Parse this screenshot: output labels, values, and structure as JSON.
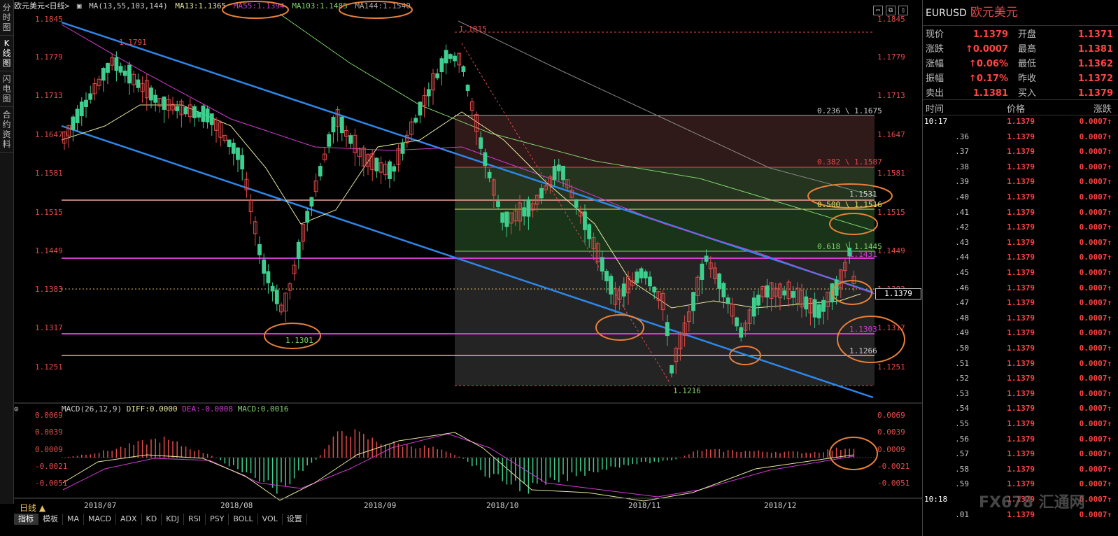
{
  "left_tabs": [
    {
      "label": "分时图"
    },
    {
      "label": "K线图"
    },
    {
      "label": "闪电图"
    },
    {
      "label": "合约资料"
    }
  ],
  "title_bar": {
    "instrument": "欧元美元<日线>",
    "ma_label": "MA(13,55,103,144)",
    "ma13": "MA13:1.1365",
    "ma55": "MA55:1.1394",
    "ma103": "MA103:1.1485",
    "ma144": "MA144:1.1540"
  },
  "price_axis": [
    "1.1845",
    "1.1779",
    "1.1713",
    "1.1647",
    "1.1581",
    "1.1515",
    "1.1449",
    "1.1383",
    "1.1317",
    "1.1251"
  ],
  "annotations": {
    "high1": "1.1791",
    "high2": "1.1815",
    "low1": "1.1301",
    "low2": "1.1216",
    "fib236": "0.236 \\ 1.1675",
    "fib382": "0.382 \\ 1.1587",
    "fib500": "0.500 \\ 1.1516",
    "fib618": "0.618 \\ 1.1445",
    "lvl1531": "1.1531",
    "lvl1431": "1.1431",
    "lvl1303": "1.1303",
    "lvl1266": "1.1266",
    "current_price_tag": "1.1379",
    "right_1383": "1.1383"
  },
  "macd": {
    "label": "MACD(26,12,9)",
    "diff": "DIFF:0.0000",
    "dea": "DEA:-0.0008",
    "macd": "MACD:0.0016",
    "axis": [
      "0.0069",
      "0.0039",
      "0.0009",
      "-0.0021",
      "-0.0051"
    ]
  },
  "x_axis": [
    "2018/07",
    "2018/08",
    "2018/09",
    "2018/10",
    "2018/11",
    "2018/12"
  ],
  "bottom_tabs": [
    "指标",
    "模板",
    "MA",
    "MACD",
    "ADX",
    "KD",
    "KDJ",
    "RSI",
    "PSY",
    "BOLL",
    "VOL",
    "设置"
  ],
  "period_label": "日线 ▲",
  "quote": {
    "symbol": "EURUSD",
    "name": "欧元美元",
    "rows": [
      {
        "l1": "现价",
        "v1": "1.1379",
        "l2": "开盘",
        "v2": "1.1371"
      },
      {
        "l1": "涨跌",
        "v1": "↑0.0007",
        "l2": "最高",
        "v2": "1.1381"
      },
      {
        "l1": "涨幅",
        "v1": "↑0.06%",
        "l2": "最低",
        "v2": "1.1362"
      },
      {
        "l1": "振幅",
        "v1": "↑0.17%",
        "l2": "昨收",
        "v2": "1.1372"
      },
      {
        "l1": "卖出",
        "v1": "1.1381",
        "l2": "买入",
        "v2": "1.1379"
      }
    ]
  },
  "ticks_header": {
    "time": "时间",
    "price": "价格",
    "change": "涨跌"
  },
  "ticks": [
    {
      "t": "10:17",
      "p": "1.1379",
      "c": "0.0007↑"
    },
    {
      "t": ".36",
      "p": "1.1379",
      "c": "0.0007↑"
    },
    {
      "t": ".37",
      "p": "1.1379",
      "c": "0.0007↑"
    },
    {
      "t": ".38",
      "p": "1.1379",
      "c": "0.0007↑"
    },
    {
      "t": ".39",
      "p": "1.1379",
      "c": "0.0007↑"
    },
    {
      "t": ".40",
      "p": "1.1379",
      "c": "0.0007↑"
    },
    {
      "t": ".41",
      "p": "1.1379",
      "c": "0.0007↑"
    },
    {
      "t": ".42",
      "p": "1.1379",
      "c": "0.0007↑"
    },
    {
      "t": ".43",
      "p": "1.1379",
      "c": "0.0007↑"
    },
    {
      "t": ".44",
      "p": "1.1379",
      "c": "0.0007↑"
    },
    {
      "t": ".45",
      "p": "1.1379",
      "c": "0.0007↑"
    },
    {
      "t": ".46",
      "p": "1.1379",
      "c": "0.0007↑"
    },
    {
      "t": ".47",
      "p": "1.1379",
      "c": "0.0007↑"
    },
    {
      "t": ".48",
      "p": "1.1379",
      "c": "0.0007↑"
    },
    {
      "t": ".49",
      "p": "1.1379",
      "c": "0.0007↑"
    },
    {
      "t": ".50",
      "p": "1.1379",
      "c": "0.0007↑"
    },
    {
      "t": ".51",
      "p": "1.1379",
      "c": "0.0007↑"
    },
    {
      "t": ".52",
      "p": "1.1379",
      "c": "0.0007↑"
    },
    {
      "t": ".53",
      "p": "1.1379",
      "c": "0.0007↑"
    },
    {
      "t": ".54",
      "p": "1.1379",
      "c": "0.0007↑"
    },
    {
      "t": ".55",
      "p": "1.1379",
      "c": "0.0007↑"
    },
    {
      "t": ".56",
      "p": "1.1379",
      "c": "0.0007↑"
    },
    {
      "t": ".57",
      "p": "1.1379",
      "c": "0.0007↑"
    },
    {
      "t": ".58",
      "p": "1.1379",
      "c": "0.0007↑"
    },
    {
      "t": ".59",
      "p": "1.1379",
      "c": "0.0007↑"
    },
    {
      "t": "10:18",
      "p": "1.1379",
      "c": "0.0007↑"
    },
    {
      "t": ".01",
      "p": "1.1379",
      "c": "0.0007↑"
    }
  ],
  "watermark": "FX678 汇通网",
  "colors": {
    "up": "#e34b4b",
    "down": "#3ecf8e",
    "channel": "#2e86e8",
    "magenta": "#d33ad3",
    "salmon": "#f08d80",
    "orange": "#e8803a"
  }
}
